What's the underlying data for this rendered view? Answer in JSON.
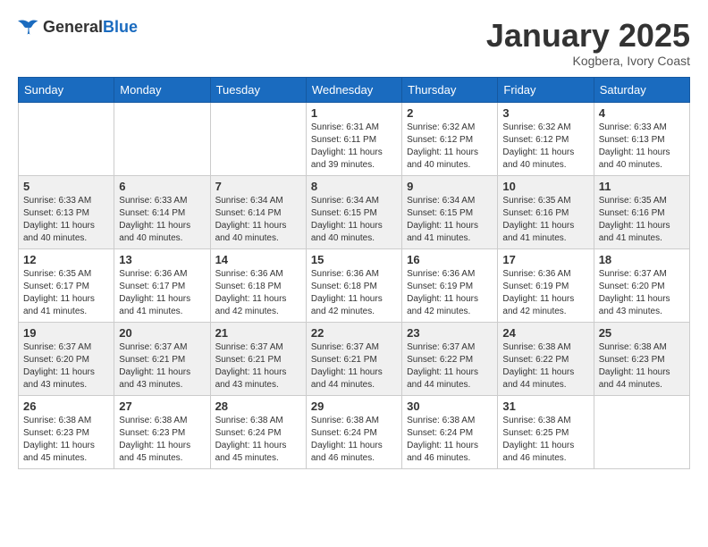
{
  "logo": {
    "general": "General",
    "blue": "Blue"
  },
  "header": {
    "month": "January 2025",
    "location": "Kogbera, Ivory Coast"
  },
  "weekdays": [
    "Sunday",
    "Monday",
    "Tuesday",
    "Wednesday",
    "Thursday",
    "Friday",
    "Saturday"
  ],
  "weeks": [
    [
      {
        "day": "",
        "info": ""
      },
      {
        "day": "",
        "info": ""
      },
      {
        "day": "",
        "info": ""
      },
      {
        "day": "1",
        "info": "Sunrise: 6:31 AM\nSunset: 6:11 PM\nDaylight: 11 hours\nand 39 minutes."
      },
      {
        "day": "2",
        "info": "Sunrise: 6:32 AM\nSunset: 6:12 PM\nDaylight: 11 hours\nand 40 minutes."
      },
      {
        "day": "3",
        "info": "Sunrise: 6:32 AM\nSunset: 6:12 PM\nDaylight: 11 hours\nand 40 minutes."
      },
      {
        "day": "4",
        "info": "Sunrise: 6:33 AM\nSunset: 6:13 PM\nDaylight: 11 hours\nand 40 minutes."
      }
    ],
    [
      {
        "day": "5",
        "info": "Sunrise: 6:33 AM\nSunset: 6:13 PM\nDaylight: 11 hours\nand 40 minutes."
      },
      {
        "day": "6",
        "info": "Sunrise: 6:33 AM\nSunset: 6:14 PM\nDaylight: 11 hours\nand 40 minutes."
      },
      {
        "day": "7",
        "info": "Sunrise: 6:34 AM\nSunset: 6:14 PM\nDaylight: 11 hours\nand 40 minutes."
      },
      {
        "day": "8",
        "info": "Sunrise: 6:34 AM\nSunset: 6:15 PM\nDaylight: 11 hours\nand 40 minutes."
      },
      {
        "day": "9",
        "info": "Sunrise: 6:34 AM\nSunset: 6:15 PM\nDaylight: 11 hours\nand 41 minutes."
      },
      {
        "day": "10",
        "info": "Sunrise: 6:35 AM\nSunset: 6:16 PM\nDaylight: 11 hours\nand 41 minutes."
      },
      {
        "day": "11",
        "info": "Sunrise: 6:35 AM\nSunset: 6:16 PM\nDaylight: 11 hours\nand 41 minutes."
      }
    ],
    [
      {
        "day": "12",
        "info": "Sunrise: 6:35 AM\nSunset: 6:17 PM\nDaylight: 11 hours\nand 41 minutes."
      },
      {
        "day": "13",
        "info": "Sunrise: 6:36 AM\nSunset: 6:17 PM\nDaylight: 11 hours\nand 41 minutes."
      },
      {
        "day": "14",
        "info": "Sunrise: 6:36 AM\nSunset: 6:18 PM\nDaylight: 11 hours\nand 42 minutes."
      },
      {
        "day": "15",
        "info": "Sunrise: 6:36 AM\nSunset: 6:18 PM\nDaylight: 11 hours\nand 42 minutes."
      },
      {
        "day": "16",
        "info": "Sunrise: 6:36 AM\nSunset: 6:19 PM\nDaylight: 11 hours\nand 42 minutes."
      },
      {
        "day": "17",
        "info": "Sunrise: 6:36 AM\nSunset: 6:19 PM\nDaylight: 11 hours\nand 42 minutes."
      },
      {
        "day": "18",
        "info": "Sunrise: 6:37 AM\nSunset: 6:20 PM\nDaylight: 11 hours\nand 43 minutes."
      }
    ],
    [
      {
        "day": "19",
        "info": "Sunrise: 6:37 AM\nSunset: 6:20 PM\nDaylight: 11 hours\nand 43 minutes."
      },
      {
        "day": "20",
        "info": "Sunrise: 6:37 AM\nSunset: 6:21 PM\nDaylight: 11 hours\nand 43 minutes."
      },
      {
        "day": "21",
        "info": "Sunrise: 6:37 AM\nSunset: 6:21 PM\nDaylight: 11 hours\nand 43 minutes."
      },
      {
        "day": "22",
        "info": "Sunrise: 6:37 AM\nSunset: 6:21 PM\nDaylight: 11 hours\nand 44 minutes."
      },
      {
        "day": "23",
        "info": "Sunrise: 6:37 AM\nSunset: 6:22 PM\nDaylight: 11 hours\nand 44 minutes."
      },
      {
        "day": "24",
        "info": "Sunrise: 6:38 AM\nSunset: 6:22 PM\nDaylight: 11 hours\nand 44 minutes."
      },
      {
        "day": "25",
        "info": "Sunrise: 6:38 AM\nSunset: 6:23 PM\nDaylight: 11 hours\nand 44 minutes."
      }
    ],
    [
      {
        "day": "26",
        "info": "Sunrise: 6:38 AM\nSunset: 6:23 PM\nDaylight: 11 hours\nand 45 minutes."
      },
      {
        "day": "27",
        "info": "Sunrise: 6:38 AM\nSunset: 6:23 PM\nDaylight: 11 hours\nand 45 minutes."
      },
      {
        "day": "28",
        "info": "Sunrise: 6:38 AM\nSunset: 6:24 PM\nDaylight: 11 hours\nand 45 minutes."
      },
      {
        "day": "29",
        "info": "Sunrise: 6:38 AM\nSunset: 6:24 PM\nDaylight: 11 hours\nand 46 minutes."
      },
      {
        "day": "30",
        "info": "Sunrise: 6:38 AM\nSunset: 6:24 PM\nDaylight: 11 hours\nand 46 minutes."
      },
      {
        "day": "31",
        "info": "Sunrise: 6:38 AM\nSunset: 6:25 PM\nDaylight: 11 hours\nand 46 minutes."
      },
      {
        "day": "",
        "info": ""
      }
    ]
  ]
}
